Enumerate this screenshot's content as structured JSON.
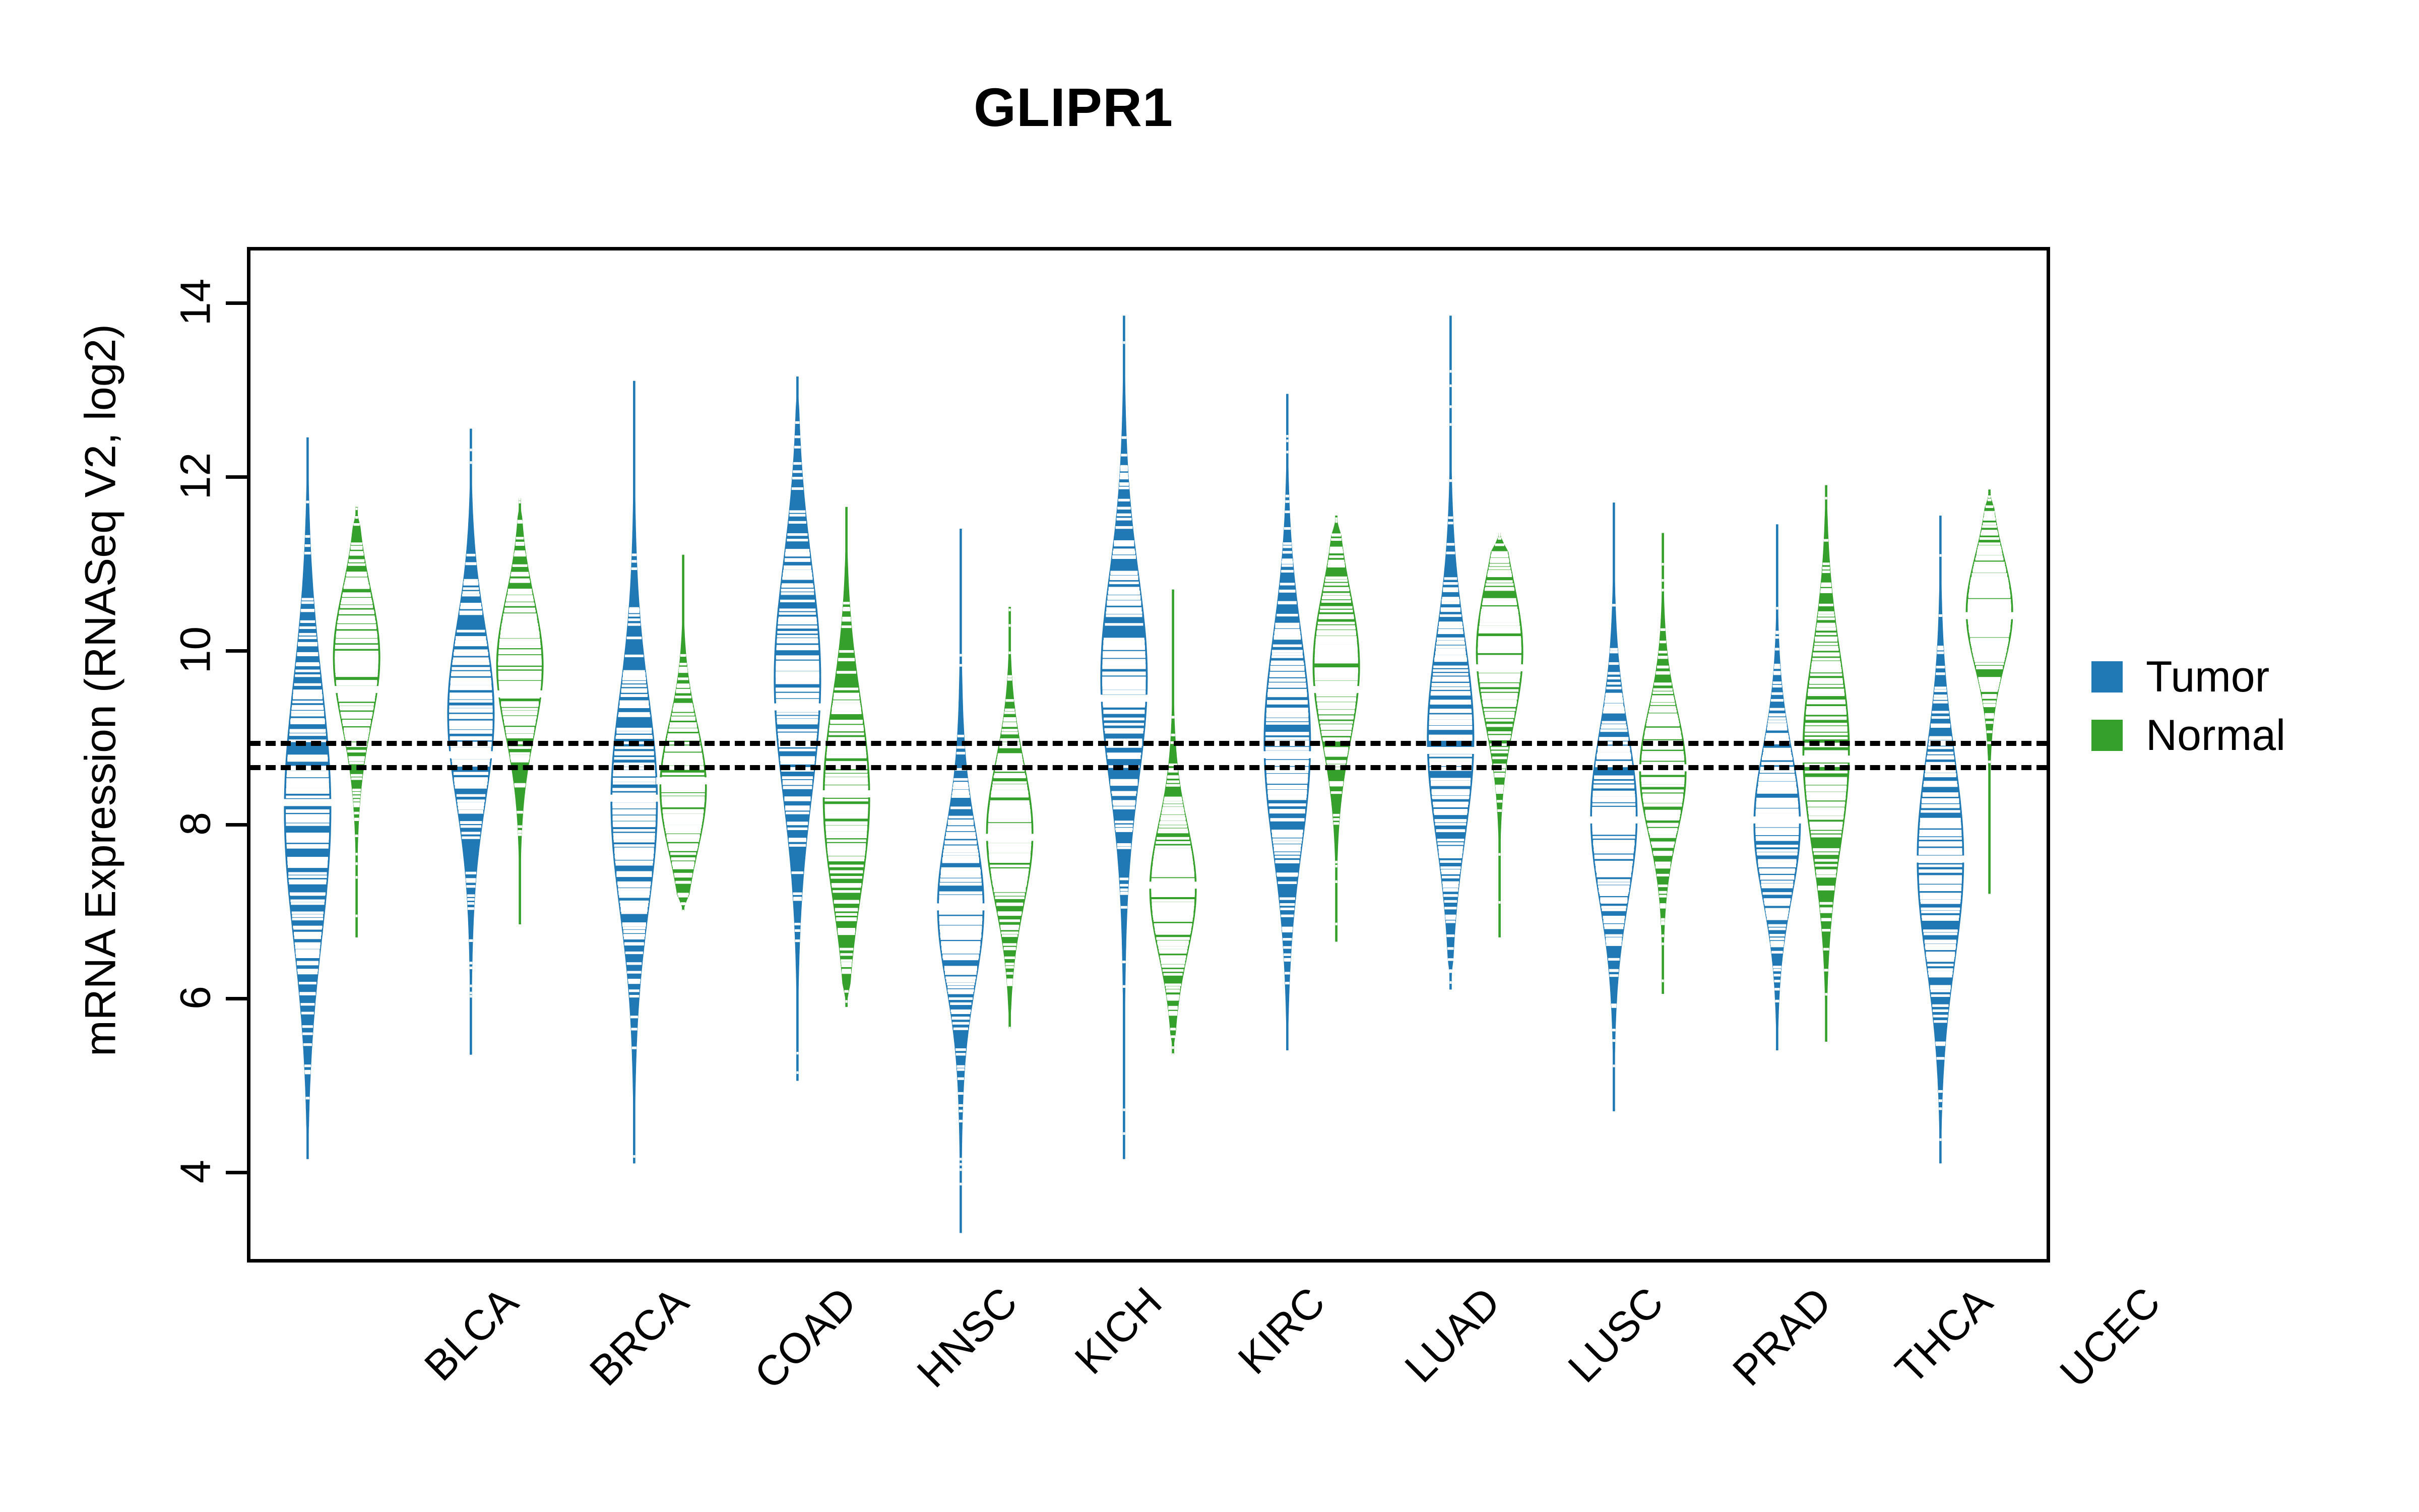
{
  "title": "GLIPR1",
  "axes": {
    "ylabel": "mRNA Expression (RNASeq V2, log2)",
    "xlabel": "",
    "yticks": [
      "4",
      "6",
      "8",
      "10",
      "12",
      "14"
    ],
    "ylim": [
      3.0,
      14.6
    ]
  },
  "legend": {
    "position": "right",
    "items": [
      {
        "label": "Tumor",
        "color": "#2079B4"
      },
      {
        "label": "Normal",
        "color": "#35A02B"
      }
    ]
  },
  "colors": {
    "tumor": "#2079B4",
    "normal": "#35A02B",
    "frame": "#000000",
    "reference_line": "#000000",
    "background": "#FFFFFF"
  },
  "reference_lines": [
    {
      "value": 8.96,
      "style": "dashed"
    },
    {
      "value": 8.68,
      "style": "dashed"
    }
  ],
  "chart_data": {
    "type": "violin",
    "title": "GLIPR1",
    "xlabel": "",
    "ylabel": "mRNA Expression (RNASeq V2, log2)",
    "ylim": [
      3.0,
      14.6
    ],
    "grid": false,
    "legend_position": "right",
    "categories": [
      "BLCA",
      "BRCA",
      "COAD",
      "HNSC",
      "KICH",
      "KIRC",
      "LUAD",
      "LUSC",
      "PRAD",
      "THCA",
      "UCEC"
    ],
    "series": [
      {
        "name": "Tumor",
        "color": "#2079B4",
        "groups": [
          {
            "category": "BLCA",
            "median": 8.25,
            "q1": 7.55,
            "q3": 9.55,
            "min": 4.15,
            "max": 12.45,
            "peak": 8.15,
            "width": 1.0
          },
          {
            "category": "BRCA",
            "median": 8.8,
            "q1": 8.2,
            "q3": 9.55,
            "min": 5.35,
            "max": 12.55,
            "peak": 9.3,
            "width": 1.0
          },
          {
            "category": "COAD",
            "median": 8.3,
            "q1": 7.45,
            "q3": 9.1,
            "min": 4.1,
            "max": 13.1,
            "peak": 8.25,
            "width": 1.0
          },
          {
            "category": "HNSC",
            "median": 9.35,
            "q1": 8.4,
            "q3": 10.2,
            "min": 5.05,
            "max": 13.15,
            "peak": 9.7,
            "width": 1.0
          },
          {
            "category": "KICH",
            "median": 7.05,
            "q1": 6.35,
            "q3": 7.55,
            "min": 3.3,
            "max": 11.4,
            "peak": 7.05,
            "width": 1.0
          },
          {
            "category": "KIRC",
            "median": 9.45,
            "q1": 8.7,
            "q3": 10.3,
            "min": 4.15,
            "max": 13.85,
            "peak": 9.7,
            "width": 1.0
          },
          {
            "category": "LUAD",
            "median": 8.8,
            "q1": 8.05,
            "q3": 9.7,
            "min": 5.4,
            "max": 12.95,
            "peak": 8.95,
            "width": 1.0
          },
          {
            "category": "LUSC",
            "median": 8.85,
            "q1": 8.15,
            "q3": 9.7,
            "min": 6.1,
            "max": 13.85,
            "peak": 9.0,
            "width": 1.0
          },
          {
            "category": "PRAD",
            "median": 8.05,
            "q1": 7.45,
            "q3": 8.75,
            "min": 4.7,
            "max": 11.7,
            "peak": 8.1,
            "width": 1.0
          },
          {
            "category": "THCA",
            "median": 8.05,
            "q1": 7.45,
            "q3": 8.6,
            "min": 5.4,
            "max": 11.45,
            "peak": 8.0,
            "width": 1.0
          },
          {
            "category": "UCEC",
            "median": 7.6,
            "q1": 6.85,
            "q3": 8.45,
            "min": 4.1,
            "max": 11.55,
            "peak": 7.6,
            "width": 1.0
          }
        ]
      },
      {
        "name": "Normal",
        "color": "#35A02B",
        "groups": [
          {
            "category": "BLCA",
            "median": 9.55,
            "q1": 9.1,
            "q3": 10.15,
            "min": 6.7,
            "max": 11.65,
            "peak": 9.95,
            "width": 1.0
          },
          {
            "category": "BRCA",
            "median": 9.5,
            "q1": 9.0,
            "q3": 10.05,
            "min": 6.85,
            "max": 11.75,
            "peak": 9.85,
            "width": 1.0
          },
          {
            "category": "COAD",
            "median": 8.5,
            "q1": 8.0,
            "q3": 9.0,
            "min": 7.0,
            "max": 11.1,
            "peak": 8.4,
            "width": 1.0
          },
          {
            "category": "HNSC",
            "median": 8.35,
            "q1": 7.7,
            "q3": 9.25,
            "min": 5.9,
            "max": 11.65,
            "peak": 8.3,
            "width": 1.0
          },
          {
            "category": "KICH",
            "median": 7.85,
            "q1": 7.35,
            "q3": 8.45,
            "min": 5.65,
            "max": 10.5,
            "peak": 7.9,
            "width": 1.0
          },
          {
            "category": "KIRC",
            "median": 7.3,
            "q1": 6.9,
            "q3": 7.9,
            "min": 5.35,
            "max": 10.7,
            "peak": 7.25,
            "width": 1.0
          },
          {
            "category": "LUAD",
            "median": 9.55,
            "q1": 9.0,
            "q3": 10.15,
            "min": 6.65,
            "max": 11.55,
            "peak": 9.85,
            "width": 1.0
          },
          {
            "category": "LUSC",
            "median": 9.8,
            "q1": 9.25,
            "q3": 10.35,
            "min": 6.7,
            "max": 11.35,
            "peak": 10.0,
            "width": 1.0
          },
          {
            "category": "PRAD",
            "median": 8.65,
            "q1": 8.15,
            "q3": 9.1,
            "min": 6.05,
            "max": 11.35,
            "peak": 8.6,
            "width": 1.0
          },
          {
            "category": "THCA",
            "median": 8.75,
            "q1": 8.0,
            "q3": 9.5,
            "min": 5.5,
            "max": 11.9,
            "peak": 8.85,
            "width": 1.0
          },
          {
            "category": "UCEC",
            "median": 10.4,
            "q1": 9.95,
            "q3": 10.8,
            "min": 7.2,
            "max": 11.85,
            "peak": 10.45,
            "width": 1.0
          }
        ]
      }
    ]
  }
}
